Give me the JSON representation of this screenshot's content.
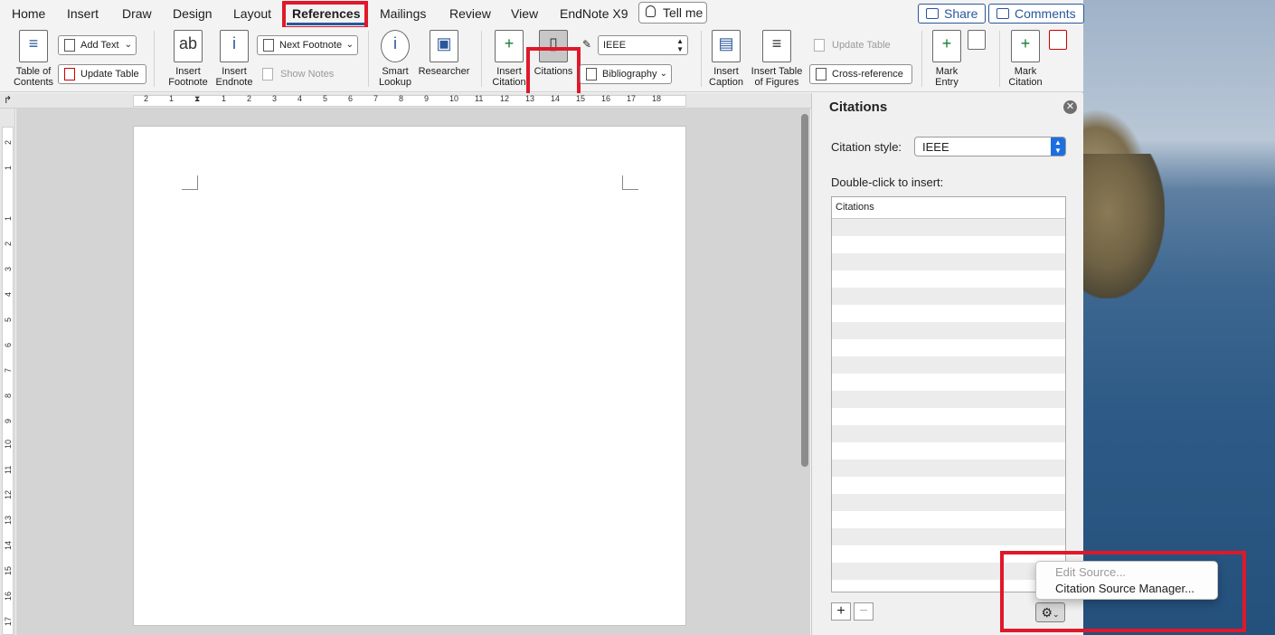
{
  "tabs": [
    "Home",
    "Insert",
    "Draw",
    "Design",
    "Layout",
    "References",
    "Mailings",
    "Review",
    "View",
    "EndNote X9"
  ],
  "active_tab": "References",
  "tell_me": "Tell me",
  "share_label": "Share",
  "comments_label": "Comments",
  "ribbon": {
    "toc_label": "Table of\nContents",
    "add_text": "Add Text",
    "update_table": "Update Table",
    "insert_footnote": "Insert\nFootnote",
    "insert_endnote": "Insert\nEndnote",
    "next_footnote": "Next Footnote",
    "show_notes": "Show Notes",
    "smart_lookup": "Smart\nLookup",
    "researcher": "Researcher",
    "insert_citation": "Insert\nCitation",
    "citations": "Citations",
    "style_value": "IEEE",
    "bibliography": "Bibliography",
    "insert_caption": "Insert\nCaption",
    "insert_table_of_figures": "Insert Table\nof Figures",
    "update_table_fig": "Update Table",
    "cross_reference": "Cross-reference",
    "mark_entry": "Mark\nEntry",
    "mark_citation": "Mark\nCitation"
  },
  "ruler_h": [
    "2",
    "1",
    "1",
    "2",
    "3",
    "4",
    "5",
    "6",
    "7",
    "8",
    "9",
    "10",
    "11",
    "12",
    "13",
    "14",
    "15",
    "16",
    "17",
    "18"
  ],
  "ruler_v": [
    "2",
    "1",
    "1",
    "2",
    "3",
    "4",
    "5",
    "6",
    "7",
    "8",
    "9",
    "10",
    "11",
    "12",
    "13",
    "14",
    "15",
    "16",
    "17"
  ],
  "pane": {
    "title": "Citations",
    "style_label": "Citation style:",
    "style_value": "IEEE",
    "insert_hint": "Double-click to insert:",
    "list_header": "Citations",
    "add": "+",
    "remove": "−"
  },
  "menu": {
    "edit_source": "Edit Source...",
    "source_manager": "Citation Source Manager..."
  },
  "colors": {
    "accent": "#2b579a",
    "highlight": "#e0182a",
    "select_blue": "#1c6fe0"
  }
}
